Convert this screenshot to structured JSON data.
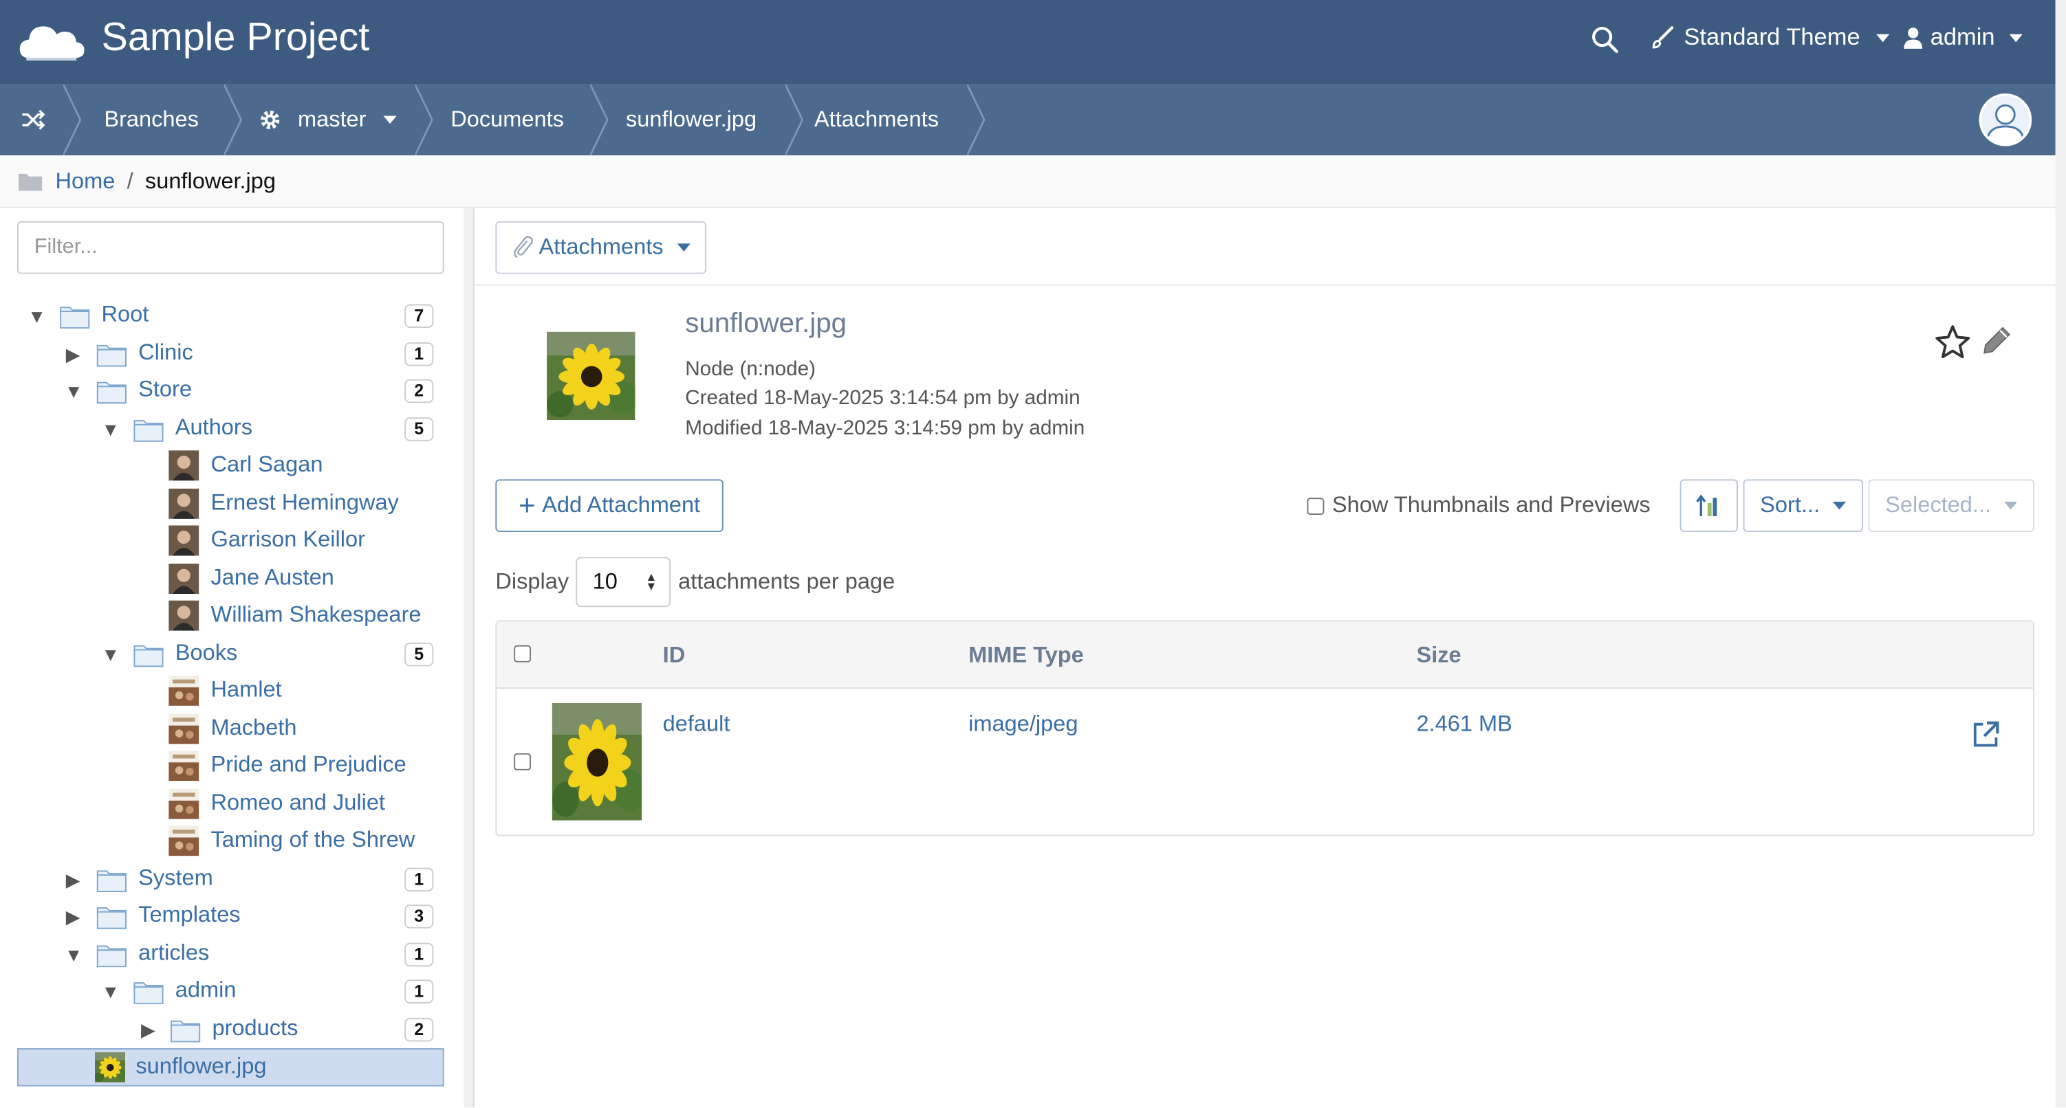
{
  "app": {
    "title": "Sample Project"
  },
  "topnav": {
    "theme_label": "Standard Theme",
    "user_label": "admin"
  },
  "crumbbar": {
    "items": [
      {
        "label": "Branches"
      },
      {
        "label": "master"
      },
      {
        "label": "Documents"
      },
      {
        "label": "sunflower.jpg"
      },
      {
        "label": "Attachments"
      }
    ]
  },
  "path": {
    "home": "Home",
    "separator": "/",
    "current": "sunflower.jpg"
  },
  "sidebar": {
    "filter_placeholder": "Filter...",
    "tree": [
      {
        "label": "Root",
        "count": "7"
      },
      {
        "label": "Clinic",
        "count": "1"
      },
      {
        "label": "Store",
        "count": "2"
      },
      {
        "label": "Authors",
        "count": "5"
      },
      {
        "label": "Carl Sagan"
      },
      {
        "label": "Ernest Hemingway"
      },
      {
        "label": "Garrison Keillor"
      },
      {
        "label": "Jane Austen"
      },
      {
        "label": "William Shakespeare"
      },
      {
        "label": "Books",
        "count": "5"
      },
      {
        "label": "Hamlet"
      },
      {
        "label": "Macbeth"
      },
      {
        "label": "Pride and Prejudice"
      },
      {
        "label": "Romeo and Juliet"
      },
      {
        "label": "Taming of the Shrew"
      },
      {
        "label": "System",
        "count": "1"
      },
      {
        "label": "Templates",
        "count": "3"
      },
      {
        "label": "articles",
        "count": "1"
      },
      {
        "label": "admin",
        "count": "1"
      },
      {
        "label": "products",
        "count": "2"
      },
      {
        "label": "sunflower.jpg"
      }
    ]
  },
  "main": {
    "attachments_dropdown": "Attachments",
    "doc": {
      "title": "sunflower.jpg",
      "type_line": "Node (n:node)",
      "created": "Created 18-May-2025 3:14:54 pm by admin",
      "modified": "Modified 18-May-2025 3:14:59 pm by admin"
    },
    "toolbar": {
      "add_label": "Add Attachment",
      "show_thumbs_label": "Show Thumbnails and Previews",
      "sort_label": "Sort...",
      "selected_label": "Selected..."
    },
    "paging": {
      "display_label": "Display",
      "per_page_value": "10",
      "per_page_suffix": "attachments per page"
    },
    "table": {
      "headers": {
        "id": "ID",
        "mime": "MIME Type",
        "size": "Size"
      },
      "rows": [
        {
          "id": "default",
          "mime": "image/jpeg",
          "size": "2.461 MB"
        }
      ]
    }
  },
  "colors": {
    "topbar": "#3d5a80",
    "crumbbar": "#4c6a8e",
    "link": "#3a6ea5",
    "selected_row": "#cfdcef"
  }
}
